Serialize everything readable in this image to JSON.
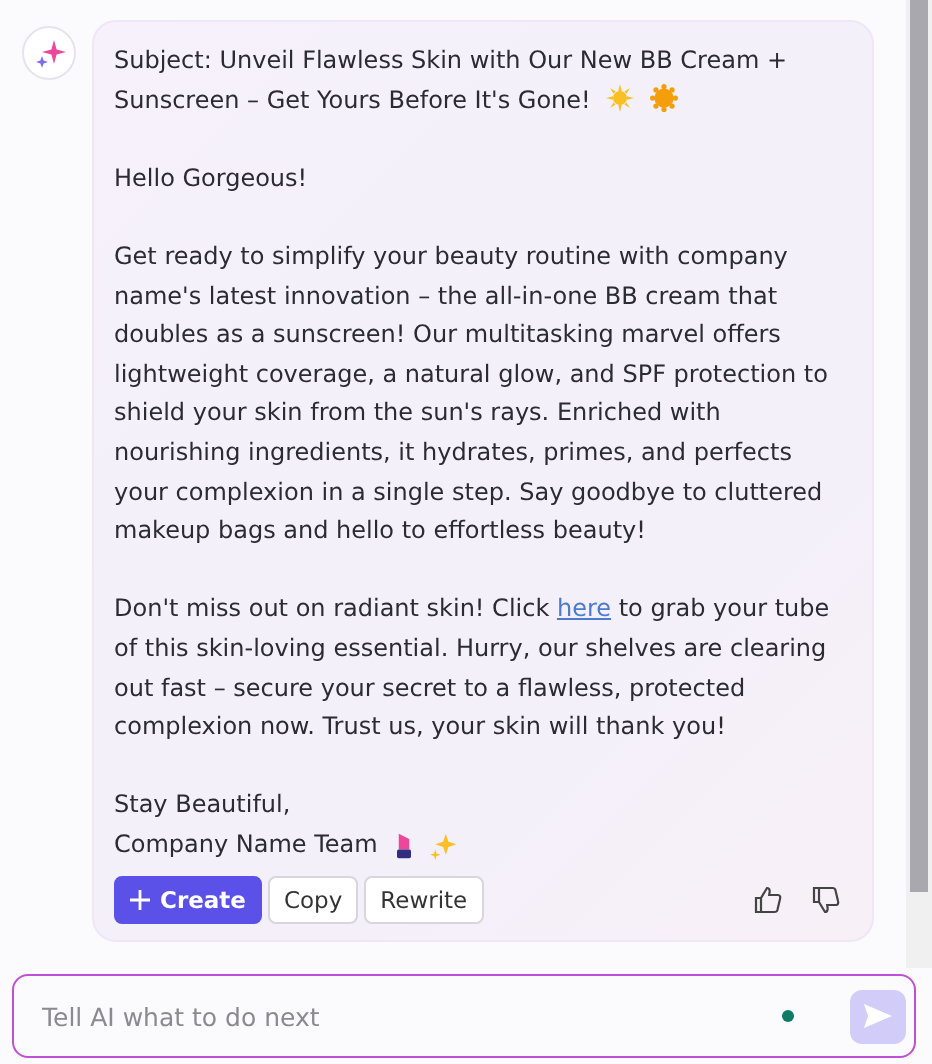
{
  "message": {
    "subject": "Subject: Unveil Flawless Skin with Our New BB Cream + Sunscreen – Get Yours Before It's Gone!",
    "greeting": "Hello Gorgeous!",
    "body": "Get ready to simplify your beauty routine with company name's latest innovation – the all-in-one BB cream that doubles as a sunscreen! Our multitasking marvel offers lightweight coverage, a natural glow, and SPF protection to shield your skin from the sun's rays. Enriched with nourishing ingredients, it hydrates, primes, and perfects your complexion in a single step. Say goodbye to cluttered makeup bags and hello to effortless beauty!",
    "cta_before": "Don't miss out on radiant skin! Click",
    "cta_link": "here",
    "cta_after": "to grab your tube of this skin-loving essential. Hurry, our shelves are clearing out fast – secure your secret to a flawless, protected complexion now. Trust us, your skin will thank you!",
    "signoff": "Stay Beautiful,",
    "signature": "Company Name Team"
  },
  "actions": [
    {
      "label": "Create",
      "kind": "primary"
    },
    {
      "label": "Copy",
      "kind": "secondary"
    },
    {
      "label": "Rewrite",
      "kind": "secondary"
    }
  ],
  "input": {
    "placeholder": "Tell AI what to do next"
  }
}
